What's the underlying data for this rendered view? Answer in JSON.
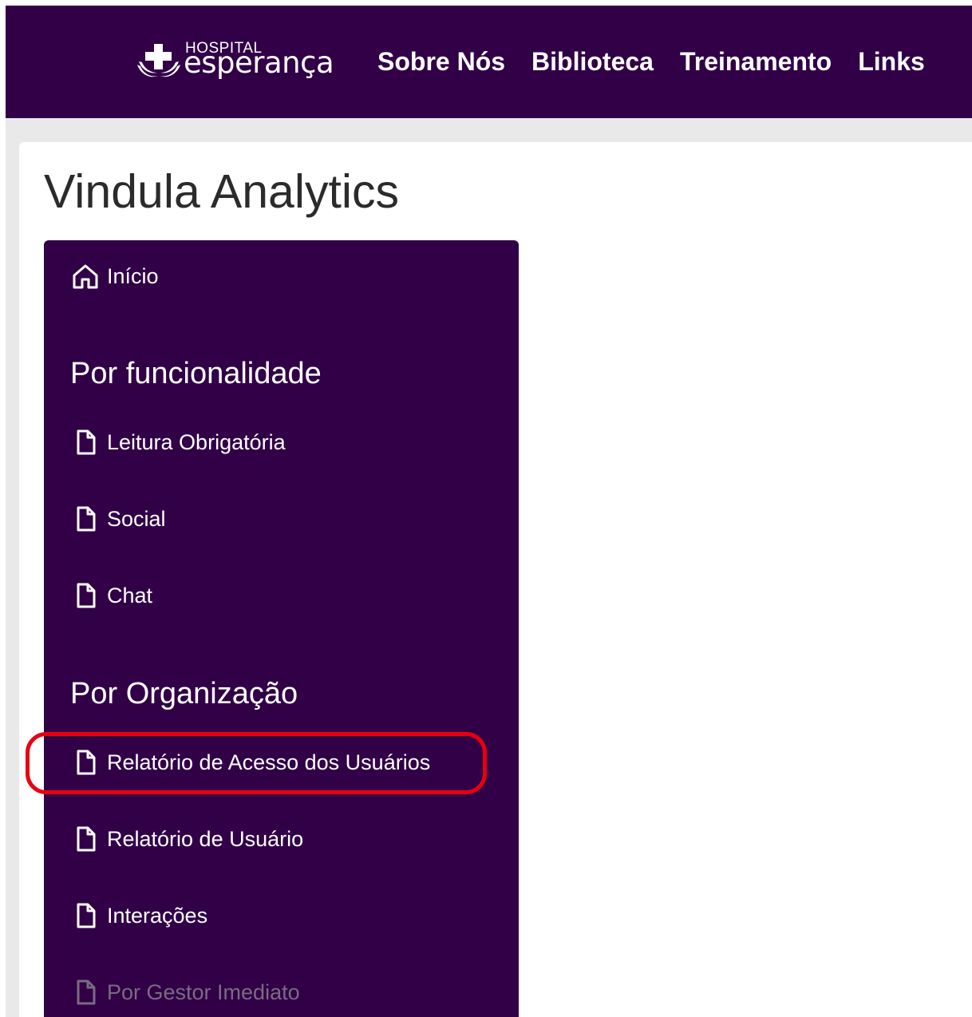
{
  "navbar": {
    "logo": {
      "small_text": "HOSPITAL",
      "big_text": "esperança"
    },
    "links": [
      "Sobre Nós",
      "Biblioteca",
      "Treinamento",
      "Links"
    ]
  },
  "page": {
    "title": "Vindula Analytics"
  },
  "sidebar": {
    "home": {
      "label": "Início",
      "icon": "home-icon"
    },
    "sections": [
      {
        "heading": "Por funcionalidade",
        "items": [
          {
            "label": "Leitura Obrigatória",
            "icon": "document-icon"
          },
          {
            "label": "Social",
            "icon": "document-icon"
          },
          {
            "label": "Chat",
            "icon": "document-icon"
          }
        ]
      },
      {
        "heading": "Por Organização",
        "items": [
          {
            "label": "Relatório de Acesso dos Usuários",
            "icon": "document-icon",
            "highlighted": true
          },
          {
            "label": "Relatório de Usuário",
            "icon": "document-icon"
          },
          {
            "label": "Interações",
            "icon": "document-icon"
          },
          {
            "label": "Por Gestor Imediato",
            "icon": "document-icon",
            "disabled": true
          }
        ]
      }
    ]
  },
  "colors": {
    "brand_purple": "#310047",
    "page_background": "#e9e9e9",
    "highlight_red": "#e8000f",
    "disabled_text": "#7a6b80"
  }
}
